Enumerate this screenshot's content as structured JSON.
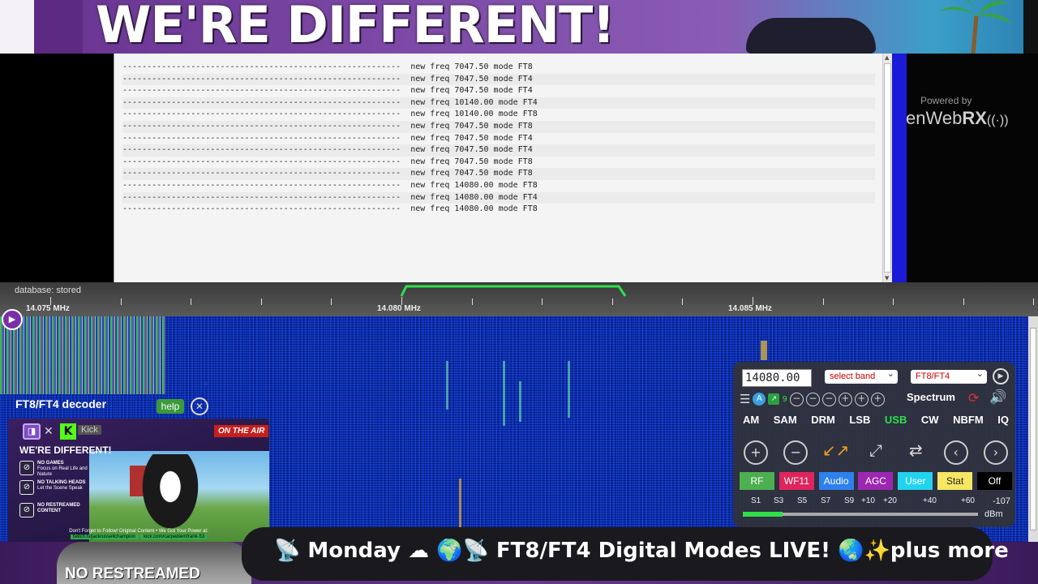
{
  "banner": {
    "text": "WE'RE DIFFERENT!"
  },
  "log": {
    "lines": [
      "---------------------------------------------------------  new freq 7047.50 mode FT8",
      "---------------------------------------------------------  new freq 7047.50 mode FT4",
      "---------------------------------------------------------  new freq 7047.50 mode FT4",
      "---------------------------------------------------------  new freq 10140.00 mode FT4",
      "---------------------------------------------------------  new freq 10140.00 mode FT8",
      "---------------------------------------------------------  new freq 7047.50 mode FT8",
      "---------------------------------------------------------  new freq 7047.50 mode FT4",
      "---------------------------------------------------------  new freq 7047.50 mode FT4",
      "---------------------------------------------------------  new freq 7047.50 mode FT8",
      "---------------------------------------------------------  new freq 7047.50 mode FT8",
      "---------------------------------------------------------  new freq 14080.00 mode FT8",
      "---------------------------------------------------------  new freq 14080.00 mode FT4",
      "---------------------------------------------------------  new freq 14080.00 mode FT8"
    ]
  },
  "powered": {
    "label": "Powered by",
    "brand_prefix": "en",
    "brand_web": "Web",
    "brand_rx": "RX"
  },
  "scale": {
    "status": "database: stored",
    "labels": [
      "14.075 MHz",
      "14.080 MHz",
      "14.085 MHz"
    ]
  },
  "receiver": {
    "frequency": "14080.00",
    "band_select": "select band",
    "mode_select": "FT8/FT4",
    "badge_a": "A",
    "badge_count": "9",
    "spectrum": "Spectrum",
    "modes": [
      "AM",
      "SAM",
      "DRM",
      "LSB",
      "USB",
      "CW",
      "NBFM",
      "IQ"
    ],
    "active_mode": "USB",
    "tabs": [
      {
        "label": "RF",
        "bg": "#4caf50",
        "color": "#ffffff"
      },
      {
        "label": "WF11",
        "bg": "#e0245e",
        "color": "#ffffff"
      },
      {
        "label": "Audio",
        "bg": "#2f80ed",
        "color": "#ffffff"
      },
      {
        "label": "AGC",
        "bg": "#9c27b0",
        "color": "#ffffff"
      },
      {
        "label": "User",
        "bg": "#22d3ee",
        "color": "#ffffff"
      },
      {
        "label": "Stat",
        "bg": "#f5e663",
        "color": "#222222"
      },
      {
        "label": "Off",
        "bg": "#000000",
        "color": "#ffffff"
      }
    ],
    "meter_labels": [
      "S1",
      "S3",
      "S5",
      "S7",
      "S9",
      "+10",
      "+20",
      "+40",
      "+60"
    ],
    "meter_value": "-107",
    "meter_unit": "dBm",
    "meter_level": 0.17
  },
  "decoder": {
    "title": "FT8/FT4 decoder",
    "help": "help"
  },
  "promo": {
    "kick_label": "Kick",
    "headline": "WE'RE DIFFERENT!",
    "on_air": "ON THE AIR",
    "items": [
      {
        "title": "NO GAMES",
        "sub": "Focus on Real Life and Nature"
      },
      {
        "title": "NO TALKING HEADS",
        "sub": "Let the Scene Speak"
      },
      {
        "title": "NO RESTREAMED CONTENT",
        "sub": ""
      }
    ],
    "footer": "Don't Forget to Follow! Original Content • We Got Your Power at:",
    "link_twitch": "twitch.tv/jackrussellchampion",
    "link_kick": "kick.com/carpediemfrank-53"
  },
  "bottom": {
    "no_restream": "NO RESTREAMED",
    "ticker": "📡 Monday ☁ 🌍📡 FT8/FT4 Digital Modes LIVE! 🌏✨plus more"
  }
}
